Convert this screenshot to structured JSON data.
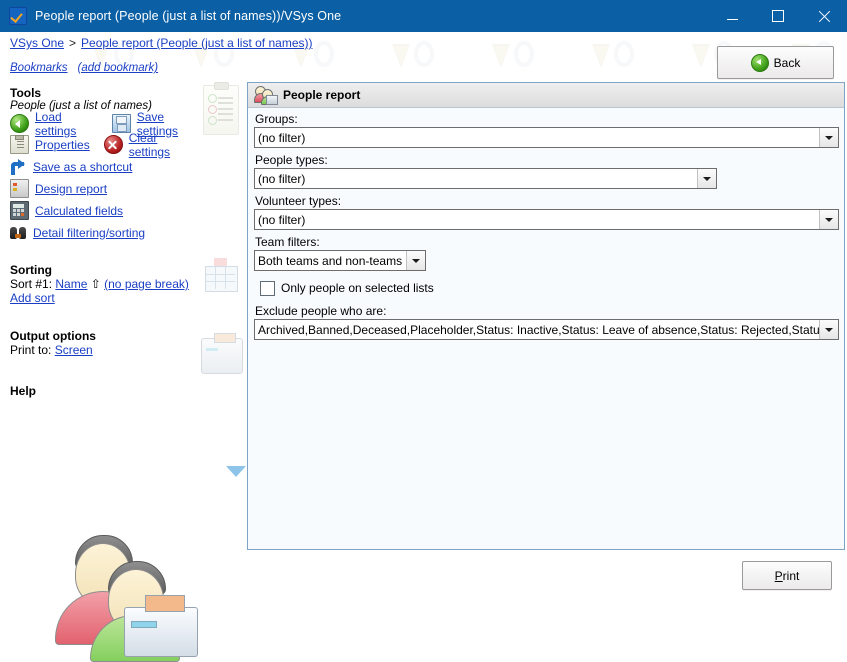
{
  "window": {
    "title": "People report (People (just a list of names))/VSys One",
    "app_icon": "vsys-shield-icon",
    "controls": {
      "minimize": "minimize-icon",
      "maximize": "maximize-icon",
      "close": "close-icon"
    },
    "titlebar_color": "#0b5fa5"
  },
  "breadcrumb": {
    "root": "VSys One",
    "separator": ">",
    "current": "People report (People (just a list of names))"
  },
  "bookmarks": {
    "label": "Bookmarks",
    "add": "(add bookmark)"
  },
  "back_button": {
    "label": "Back",
    "icon": "green-back-arrow-icon"
  },
  "sidebar": {
    "tools": {
      "heading": "Tools",
      "subtitle": "People (just a list of names)",
      "items": [
        {
          "label": "Load settings",
          "icon": "green-left-arrow-icon"
        },
        {
          "label": "Save settings",
          "icon": "floppy-disk-icon"
        },
        {
          "label": "Properties",
          "icon": "clipboard-properties-icon"
        },
        {
          "label": "Clear settings",
          "icon": "red-x-circle-icon"
        },
        {
          "label": "Save as a shortcut",
          "icon": "blue-shortcut-arrow-icon"
        },
        {
          "label": "Design report",
          "icon": "design-report-icon"
        },
        {
          "label": "Calculated fields",
          "icon": "calculator-icon"
        },
        {
          "label": "Detail filtering/sorting",
          "icon": "binoculars-icon"
        }
      ],
      "decor_icon": "clipboard-checklist-icon"
    },
    "sorting": {
      "heading": "Sorting",
      "sort_prefix": "Sort #1:",
      "sort_field": "Name",
      "sort_direction_glyph": "⇧",
      "page_break": "(no page break)",
      "add_sort": "Add sort",
      "decor_icon": "sort-descending-grid-icon"
    },
    "output": {
      "heading": "Output options",
      "print_to_label": "Print to:",
      "print_to_value": "Screen",
      "decor_icon": "printer-icon"
    },
    "help": {
      "heading": "Help",
      "toggle_icon": "blue-triangle-expander-icon"
    },
    "artwork_icon": "two-people-with-printer-icon"
  },
  "main": {
    "header": {
      "title": "People report",
      "icon": "people-report-icon"
    },
    "fields": [
      {
        "id": "groups",
        "label": "Groups:",
        "value": "(no filter)",
        "width": "full",
        "arrow_icon": "chevron-down-icon"
      },
      {
        "id": "people-types",
        "label": "People types:",
        "value": "(no filter)",
        "width": "mid",
        "arrow_icon": "chevron-down-icon"
      },
      {
        "id": "volunteer-types",
        "label": "Volunteer types:",
        "value": "(no filter)",
        "width": "full",
        "arrow_icon": "chevron-down-icon"
      },
      {
        "id": "team-filters",
        "label": "Team filters:",
        "value": "Both teams and non-teams",
        "width": "small",
        "arrow_icon": "chevron-down-icon"
      }
    ],
    "checkbox": {
      "label": "Only people on selected lists",
      "checked": false
    },
    "exclude": {
      "label": "Exclude people who are:",
      "value": "Archived,Banned,Deceased,Placeholder,Status: Inactive,Status: Leave of absence,Status: Rejected,Status: Term",
      "arrow_icon": "chevron-down-icon"
    }
  },
  "print_button": {
    "label": "Print",
    "accelerator": "P"
  },
  "colors": {
    "titlebar": "#0b5fa5",
    "link": "#1a3fc4",
    "panel_bg": "#f8fbfe",
    "panel_border": "#7fa3c4",
    "header_gradient_top": "#efefef",
    "header_gradient_bottom": "#dcdcdc"
  }
}
